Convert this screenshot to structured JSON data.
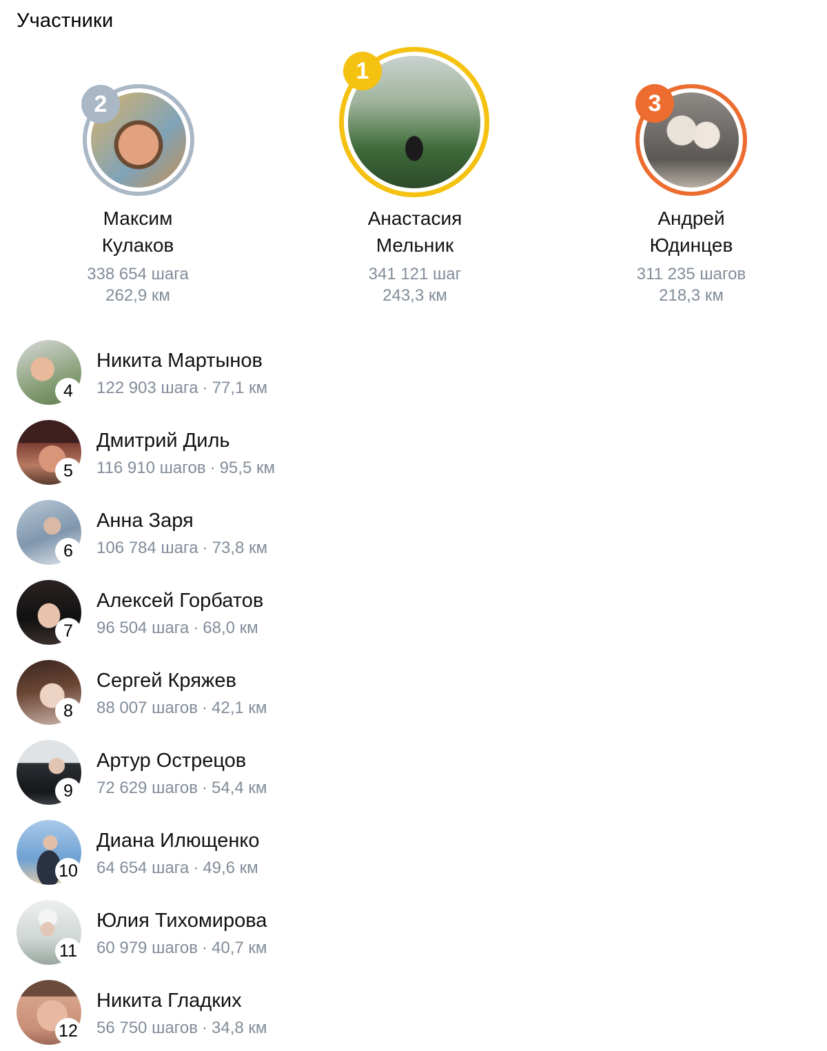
{
  "header": {
    "title": "Участники"
  },
  "podium": [
    {
      "place": "2",
      "first_name": "Максим",
      "last_name": "Кулаков",
      "steps": "338 654 шага",
      "distance": "262,9 км",
      "ring_color": "#aab7c5",
      "badge_color": "#aab7c5"
    },
    {
      "place": "1",
      "first_name": "Анастасия",
      "last_name": "Мельник",
      "steps": "341 121 шаг",
      "distance": "243,3 км",
      "ring_color": "#f5c211",
      "badge_color": "#f5c211"
    },
    {
      "place": "3",
      "first_name": "Андрей",
      "last_name": "Юдинцев",
      "steps": "311 235 шагов",
      "distance": "218,3 км",
      "ring_color": "#ed6c2f",
      "badge_color": "#ed6c2f"
    }
  ],
  "participants": [
    {
      "place": "4",
      "name": "Никита Мартынов",
      "steps": "122 903 шага",
      "separator": "·",
      "distance": "77,1 км"
    },
    {
      "place": "5",
      "name": "Дмитрий Диль",
      "steps": "116 910 шагов",
      "separator": "·",
      "distance": "95,5 км"
    },
    {
      "place": "6",
      "name": "Анна Заря",
      "steps": "106 784 шага",
      "separator": "·",
      "distance": "73,8 км"
    },
    {
      "place": "7",
      "name": "Алексей Горбатов",
      "steps": "96 504 шага",
      "separator": "·",
      "distance": "68,0 км"
    },
    {
      "place": "8",
      "name": "Сергей Кряжев",
      "steps": "88 007 шагов",
      "separator": "·",
      "distance": "42,1 км"
    },
    {
      "place": "9",
      "name": "Артур Острецов",
      "steps": "72 629 шагов",
      "separator": "·",
      "distance": "54,4 км"
    },
    {
      "place": "10",
      "name": "Диана Илющенко",
      "steps": "64 654 шага",
      "separator": "·",
      "distance": "49,6 км"
    },
    {
      "place": "11",
      "name": "Юлия Тихомирова",
      "steps": "60 979 шагов",
      "separator": "·",
      "distance": "40,7 км"
    },
    {
      "place": "12",
      "name": "Никита Гладких",
      "steps": "56 750 шагов",
      "separator": "·",
      "distance": "34,8 км"
    }
  ]
}
